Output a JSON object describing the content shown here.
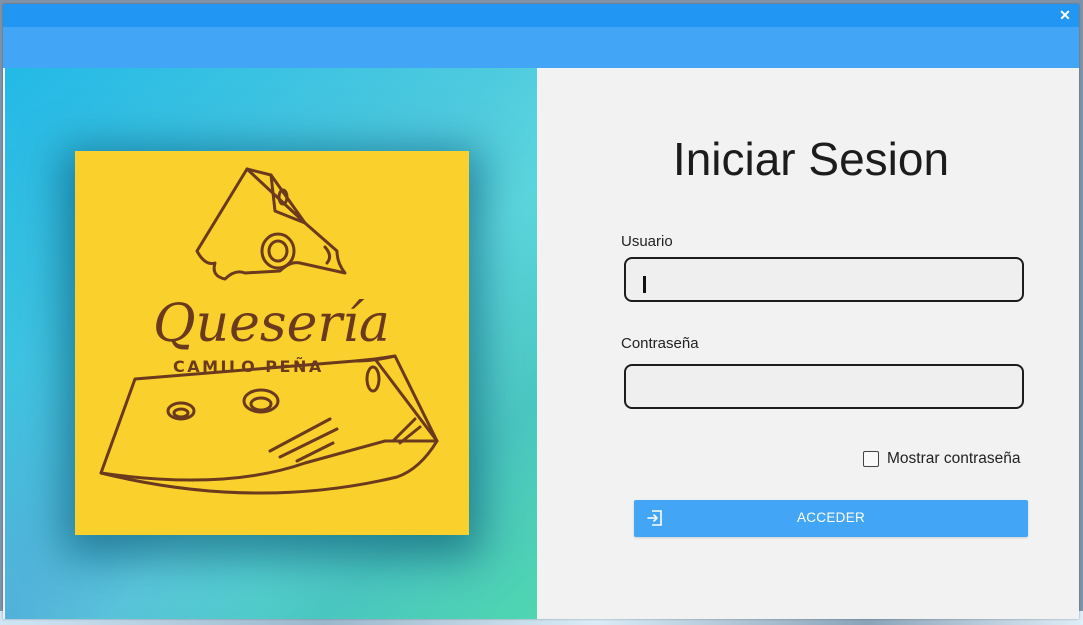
{
  "window": {
    "close_glyph": "✕"
  },
  "logo": {
    "brand_script": "Quesería",
    "brand_subtitle": "CAMILO PEÑA"
  },
  "login": {
    "title": "Iniciar Sesion",
    "username_label": "Usuario",
    "username_value": "",
    "password_label": "Contraseña",
    "password_value": "",
    "show_password_label": "Mostrar contraseña",
    "show_password_checked": false,
    "submit_label": "ACCEDER",
    "submit_icon": "login-icon"
  },
  "colors": {
    "titlebar": "#2196f3",
    "toolbar": "#42a5f5",
    "accent_button": "#42a5f5",
    "logo_background": "#fad12c",
    "logo_ink": "#6b3a1e"
  }
}
